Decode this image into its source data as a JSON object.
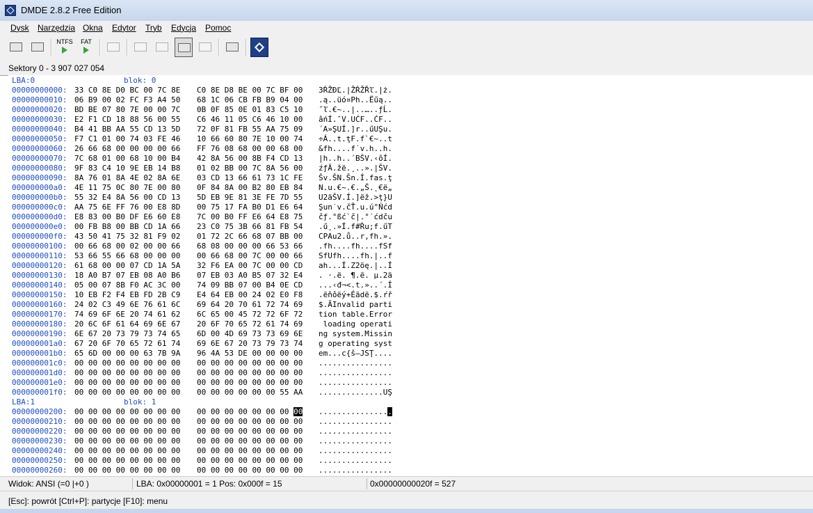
{
  "window": {
    "title": "DMDE 2.8.2 Free Edition"
  },
  "menu": [
    "Dysk",
    "Narzędzia",
    "Okna",
    "Edytor",
    "Tryb",
    "Edycja",
    "Pomoc"
  ],
  "toolbar": {
    "ntfs_label": "NTFS",
    "fat_label": "FAT"
  },
  "info": {
    "sectors": "Sektory 0 - 3 907 027 054"
  },
  "hex": {
    "sections": [
      {
        "lba": "LBA:0",
        "blok": "blok: 0",
        "rows": [
          {
            "addr": "00000000000:",
            "h1": "33 C0 8E D0 BC 00 7C 8E",
            "h2": "C0 8E D8 BE 00 7C BF 00",
            "ascii": "3ŔŽĐĽ.|ŽŔŽŘľ.|ż."
          },
          {
            "addr": "00000000010:",
            "h1": "06 B9 00 02 FC F3 A4 50",
            "h2": "68 1C 06 CB FB B9 04 00",
            "ascii": ".ą..üó¤Ph..Ëűą.."
          },
          {
            "addr": "00000000020:",
            "h1": "BD BE 07 80 7E 00 00 7C",
            "h2": "0B 0F 85 0E 01 83 C5 10",
            "ascii": "˝ľ.€~..|..…..ƒĹ."
          },
          {
            "addr": "00000000030:",
            "h1": "E2 F1 CD 18 88 56 00 55",
            "h2": "C6 46 11 05 C6 46 10 00",
            "ascii": "âńÍ.ˆV.UĆF..ĆF.."
          },
          {
            "addr": "00000000040:",
            "h1": "B4 41 BB AA 55 CD 13 5D",
            "h2": "72 0F 81 FB 55 AA 75 09",
            "ascii": "´A»ŞUÍ.]r..űUŞu."
          },
          {
            "addr": "00000000050:",
            "h1": "F7 C1 01 00 74 03 FE 46",
            "h2": "10 66 60 80 7E 10 00 74",
            "ascii": "÷Á..t.ţF.f`€~..t"
          },
          {
            "addr": "00000000060:",
            "h1": "26 66 68 00 00 00 00 66",
            "h2": "FF 76 08 68 00 00 68 00",
            "ascii": "&fh....f˙v.h..h."
          },
          {
            "addr": "00000000070:",
            "h1": "7C 68 01 00 68 10 00 B4",
            "h2": "42 8A 56 00 8B F4 CD 13",
            "ascii": "|h..h..´BŠV.‹ôÍ."
          },
          {
            "addr": "00000000080:",
            "h1": "9F 83 C4 10 9E EB 14 B8",
            "h2": "01 02 BB 00 7C 8A 56 00",
            "ascii": "źƒÄ.žë.¸..».|ŠV."
          },
          {
            "addr": "00000000090:",
            "h1": "8A 76 01 8A 4E 02 8A 6E",
            "h2": "03 CD 13 66 61 73 1C FE",
            "ascii": "Šv.ŠN.Šn.Í.fas.ţ"
          },
          {
            "addr": "000000000a0:",
            "h1": "4E 11 75 0C 80 7E 00 80",
            "h2": "0F 84 8A 00 B2 80 EB 84",
            "ascii": "N.u.€~.€.„Š.˛€ë„"
          },
          {
            "addr": "000000000b0:",
            "h1": "55 32 E4 8A 56 00 CD 13",
            "h2": "5D EB 9E 81 3E FE 7D 55",
            "ascii": "U2äŠV.Í.]ëž.>ţ}U"
          },
          {
            "addr": "000000000c0:",
            "h1": "AA 75 6E FF 76 00 E8 8D",
            "h2": "00 75 17 FA B0 D1 E6 64",
            "ascii": "Şun˙v.čŤ.u.ú°Ńćd"
          },
          {
            "addr": "000000000d0:",
            "h1": "E8 83 00 B0 DF E6 60 E8",
            "h2": "7C 00 B0 FF E6 64 E8 75",
            "ascii": "čƒ.°ßć`č|.°˙ćdču"
          },
          {
            "addr": "000000000e0:",
            "h1": "00 FB B8 00 BB CD 1A 66",
            "h2": "23 C0 75 3B 66 81 FB 54",
            "ascii": ".ű¸.»Í.f#Ŕu;f.űT"
          },
          {
            "addr": "000000000f0:",
            "h1": "43 50 41 75 32 81 F9 02",
            "h2": "01 72 2C 66 68 07 BB 00",
            "ascii": "CPAu2.ů..r,fh.»."
          },
          {
            "addr": "00000000100:",
            "h1": "00 66 68 00 02 00 00 66",
            "h2": "68 08 00 00 00 66 53 66",
            "ascii": ".fh....fh....fSf"
          },
          {
            "addr": "00000000110:",
            "h1": "53 66 55 66 68 00 00 00",
            "h2": "00 66 68 00 7C 00 00 66",
            "ascii": "SfUfh....fh.|..f"
          },
          {
            "addr": "00000000120:",
            "h1": "61 68 00 00 07 CD 1A 5A",
            "h2": "32 F6 EA 00 7C 00 00 CD",
            "ascii": "ah...Í.Z2öę.|..Í"
          },
          {
            "addr": "00000000130:",
            "h1": "18 A0 B7 07 EB 08 A0 B6",
            "h2": "07 EB 03 A0 B5 07 32 E4",
            "ascii": ". ·.ë. ¶.ë. µ.2ä"
          },
          {
            "addr": "00000000140:",
            "h1": "05 00 07 8B F0 AC 3C 00",
            "h2": "74 09 BB 07 00 B4 0E CD",
            "ascii": "...‹đ¬<.t.»..´.Í"
          },
          {
            "addr": "00000000150:",
            "h1": "10 EB F2 F4 EB FD 2B C9",
            "h2": "E4 64 EB 00 24 02 E0 F8",
            "ascii": ".ëňôëý+Éädë.$.ŕř"
          },
          {
            "addr": "00000000160:",
            "h1": "24 02 C3 49 6E 76 61 6C",
            "h2": "69 64 20 70 61 72 74 69",
            "ascii": "$.ĂInvalid parti"
          },
          {
            "addr": "00000000170:",
            "h1": "74 69 6F 6E 20 74 61 62",
            "h2": "6C 65 00 45 72 72 6F 72",
            "ascii": "tion table.Error"
          },
          {
            "addr": "00000000180:",
            "h1": "20 6C 6F 61 64 69 6E 67",
            "h2": "20 6F 70 65 72 61 74 69",
            "ascii": " loading operati"
          },
          {
            "addr": "00000000190:",
            "h1": "6E 67 20 73 79 73 74 65",
            "h2": "6D 00 4D 69 73 73 69 6E",
            "ascii": "ng system.Missin"
          },
          {
            "addr": "000000001a0:",
            "h1": "67 20 6F 70 65 72 61 74",
            "h2": "69 6E 67 20 73 79 73 74",
            "ascii": "g operating syst"
          },
          {
            "addr": "000000001b0:",
            "h1": "65 6D 00 00 00 63 7B 9A",
            "h2": "96 4A 53 DE 00 00 00 00",
            "ascii": "em...c{š–JSŢ...."
          },
          {
            "addr": "000000001c0:",
            "h1": "00 00 00 00 00 00 00 00",
            "h2": "00 00 00 00 00 00 00 00",
            "ascii": "................"
          },
          {
            "addr": "000000001d0:",
            "h1": "00 00 00 00 00 00 00 00",
            "h2": "00 00 00 00 00 00 00 00",
            "ascii": "................"
          },
          {
            "addr": "000000001e0:",
            "h1": "00 00 00 00 00 00 00 00",
            "h2": "00 00 00 00 00 00 00 00",
            "ascii": "................"
          },
          {
            "addr": "000000001f0:",
            "h1": "00 00 00 00 00 00 00 00",
            "h2": "00 00 00 00 00 00 55 AA",
            "ascii": "..............UŞ"
          }
        ]
      },
      {
        "lba": "LBA:1",
        "blok": "blok: 1",
        "rows": [
          {
            "addr": "00000000200:",
            "h1": "00 00 00 00 00 00 00 00",
            "h2": "00 00 00 00 00 00 00",
            "cursor_hex": "00",
            "ascii": "...............",
            "cursor_ascii": "."
          },
          {
            "addr": "00000000210:",
            "h1": "00 00 00 00 00 00 00 00",
            "h2": "00 00 00 00 00 00 00 00",
            "ascii": "................"
          },
          {
            "addr": "00000000220:",
            "h1": "00 00 00 00 00 00 00 00",
            "h2": "00 00 00 00 00 00 00 00",
            "ascii": "................"
          },
          {
            "addr": "00000000230:",
            "h1": "00 00 00 00 00 00 00 00",
            "h2": "00 00 00 00 00 00 00 00",
            "ascii": "................"
          },
          {
            "addr": "00000000240:",
            "h1": "00 00 00 00 00 00 00 00",
            "h2": "00 00 00 00 00 00 00 00",
            "ascii": "................"
          },
          {
            "addr": "00000000250:",
            "h1": "00 00 00 00 00 00 00 00",
            "h2": "00 00 00 00 00 00 00 00",
            "ascii": "................"
          },
          {
            "addr": "00000000260:",
            "h1": "00 00 00 00 00 00 00 00",
            "h2": "00 00 00 00 00 00 00 00",
            "ascii": "................"
          }
        ]
      }
    ]
  },
  "status": {
    "view": "Widok: ANSI (=0  |+0  )",
    "position": "LBA: 0x00000001 = 1  Pos: 0x000f = 15",
    "offset": "0x00000000020f = 527"
  },
  "help": {
    "text": "[Esc]: powrót  [Ctrl+P]: partycje  [F10]: menu"
  },
  "colors": {
    "address": "#1a4cc8",
    "brand": "#1f3f86",
    "ntfs_arrow": "#3aa43a"
  },
  "icons": [
    "app-logo-icon",
    "open-disk-icon",
    "partitions-icon",
    "play-icon",
    "file-icon",
    "directory-view-icon",
    "list-view-icon",
    "hex-view-icon",
    "search-icon",
    "copy-sectors-icon",
    "dmde-logo-icon"
  ]
}
